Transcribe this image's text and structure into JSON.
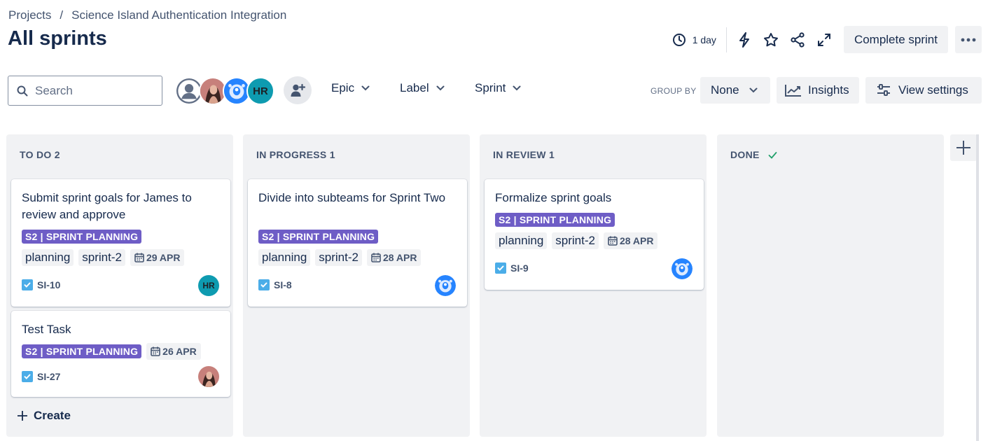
{
  "breadcrumb": {
    "root": "Projects",
    "separator": "/",
    "project": "Science Island Authentication Integration"
  },
  "page": {
    "title": "All sprints"
  },
  "sprint_actions": {
    "time_remaining": "1 day",
    "complete_label": "Complete sprint"
  },
  "search": {
    "placeholder": "Search",
    "value": ""
  },
  "avatars": {
    "hr_initials": "HR"
  },
  "filters": {
    "epic": "Epic",
    "label": "Label",
    "sprint": "Sprint"
  },
  "group_by": {
    "label": "GROUP BY",
    "value": "None"
  },
  "insights": {
    "label": "Insights"
  },
  "view_settings": {
    "label": "View settings"
  },
  "columns": [
    {
      "title": "TO DO 2",
      "cards": [
        {
          "title": "Submit sprint goals for James to review and approve",
          "epic": "S2 | SPRINT PLANNING",
          "labels": [
            "planning",
            "sprint-2"
          ],
          "date": "29 APR",
          "key": "SI-10",
          "assignee": "HR"
        },
        {
          "title": "Test Task",
          "epic": "S2 | SPRINT PLANNING",
          "labels": [],
          "date": "26 APR",
          "key": "SI-27",
          "assignee": "photo"
        }
      ],
      "create_label": "Create"
    },
    {
      "title": "IN PROGRESS 1",
      "cards": [
        {
          "title": "Divide into subteams for Sprint Two",
          "epic": "S2 | SPRINT PLANNING",
          "labels": [
            "planning",
            "sprint-2"
          ],
          "date": "28 APR",
          "key": "SI-8",
          "assignee": "robot"
        }
      ]
    },
    {
      "title": "IN REVIEW 1",
      "cards": [
        {
          "title": "Formalize sprint goals",
          "epic": "S2 | SPRINT PLANNING",
          "labels": [
            "planning",
            "sprint-2"
          ],
          "date": "28 APR",
          "key": "SI-9",
          "assignee": "robot"
        }
      ]
    },
    {
      "title": "DONE",
      "cards": []
    }
  ],
  "colors": {
    "epic": "#6e5dc6",
    "task_icon": "#4bade8",
    "done_check": "#22a06b",
    "column_bg": "#f1f2f4"
  }
}
